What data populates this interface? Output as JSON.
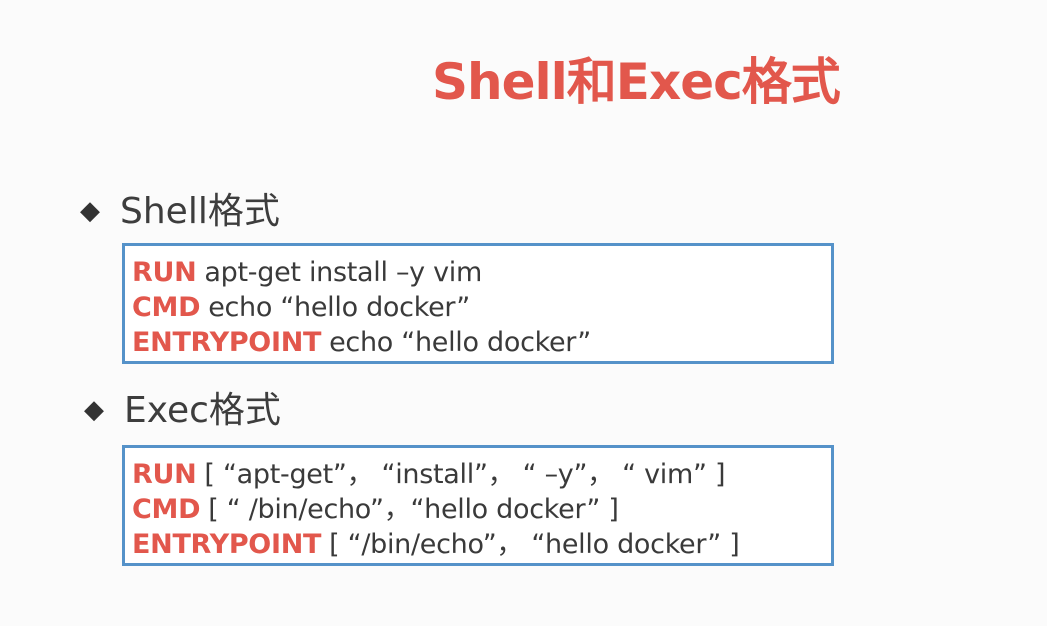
{
  "title": "Shell和Exec格式",
  "sections": [
    {
      "heading": "Shell格式",
      "bullet": "◆",
      "lines": [
        {
          "keyword": "RUN",
          "text": "apt-get install –y vim"
        },
        {
          "keyword": "CMD",
          "text": "echo  “hello docker”"
        },
        {
          "keyword": "ENTRYPOINT",
          "text": "echo  “hello docker”"
        }
      ]
    },
    {
      "heading": "Exec格式",
      "bullet": "◆",
      "lines": [
        {
          "keyword": "RUN",
          "text": "[ “apt-get”， “install”， “ –y”， “ vim” ]"
        },
        {
          "keyword": "CMD",
          "text": "[ “ /bin/echo”，“hello docker” ]"
        },
        {
          "keyword": "ENTRYPOINT",
          "text": "[ “/bin/echo”， “hello docker” ]"
        }
      ]
    }
  ],
  "colors": {
    "accent": "#e2574c",
    "box_border": "#5592c9",
    "text": "#3a3a3a"
  }
}
